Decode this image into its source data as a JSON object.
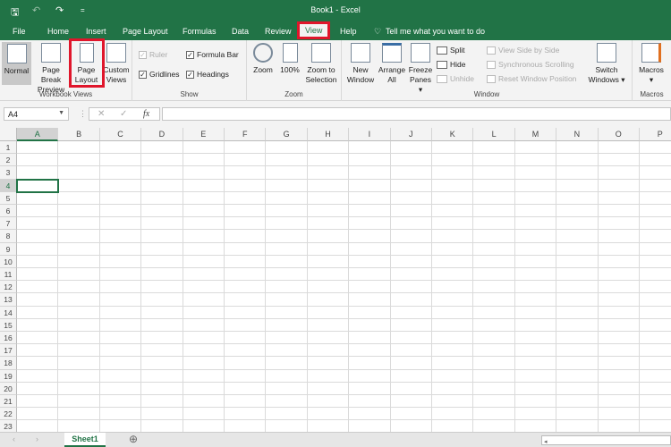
{
  "window": {
    "title": "Book1  -  Excel"
  },
  "qat": {
    "save": "🖫",
    "undo": "↶",
    "redo": "↷",
    "customize": "="
  },
  "tabs": [
    {
      "label": "File"
    },
    {
      "label": "Home"
    },
    {
      "label": "Insert"
    },
    {
      "label": "Page Layout"
    },
    {
      "label": "Formulas"
    },
    {
      "label": "Data"
    },
    {
      "label": "Review"
    },
    {
      "label": "View",
      "active": true
    },
    {
      "label": "Help"
    }
  ],
  "tell_me": "Tell me what you want to do",
  "ribbon": {
    "workbook_views": {
      "label": "Workbook Views",
      "normal": "Normal",
      "page_break": "Page Break Preview",
      "page_layout_1": "Page",
      "page_layout_2": "Layout",
      "custom_1": "Custom",
      "custom_2": "Views"
    },
    "show": {
      "label": "Show",
      "ruler": "Ruler",
      "formula_bar": "Formula Bar",
      "gridlines": "Gridlines",
      "headings": "Headings"
    },
    "zoom": {
      "label": "Zoom",
      "zoom": "Zoom",
      "hundred": "100%",
      "sel_1": "Zoom to",
      "sel_2": "Selection"
    },
    "window": {
      "label": "Window",
      "new_1": "New",
      "new_2": "Window",
      "arr_1": "Arrange",
      "arr_2": "All",
      "frz_1": "Freeze",
      "frz_2": "Panes ▾",
      "split": "Split",
      "hide": "Hide",
      "unhide": "Unhide",
      "side": "View Side by Side",
      "sync": "Synchronous Scrolling",
      "reset": "Reset Window Position",
      "sw_1": "Switch",
      "sw_2": "Windows ▾"
    },
    "macros": {
      "label": "Macros",
      "btn": "Macros",
      "arrow": "▾"
    }
  },
  "formula_bar": {
    "name_box": "A4",
    "cancel": "✕",
    "enter": "✓",
    "fx": "fx",
    "value": ""
  },
  "columns": [
    "A",
    "B",
    "C",
    "D",
    "E",
    "F",
    "G",
    "H",
    "I",
    "J",
    "K",
    "L",
    "M",
    "N",
    "O",
    "P"
  ],
  "rows": [
    "1",
    "2",
    "3",
    "4",
    "5",
    "6",
    "7",
    "8",
    "9",
    "10",
    "11",
    "12",
    "13",
    "14",
    "15",
    "16",
    "17",
    "18",
    "19",
    "20",
    "21",
    "22",
    "23"
  ],
  "selected_cell": "A4",
  "sheets": [
    {
      "label": "Sheet1",
      "active": true
    }
  ],
  "add_sheet": "⊕"
}
